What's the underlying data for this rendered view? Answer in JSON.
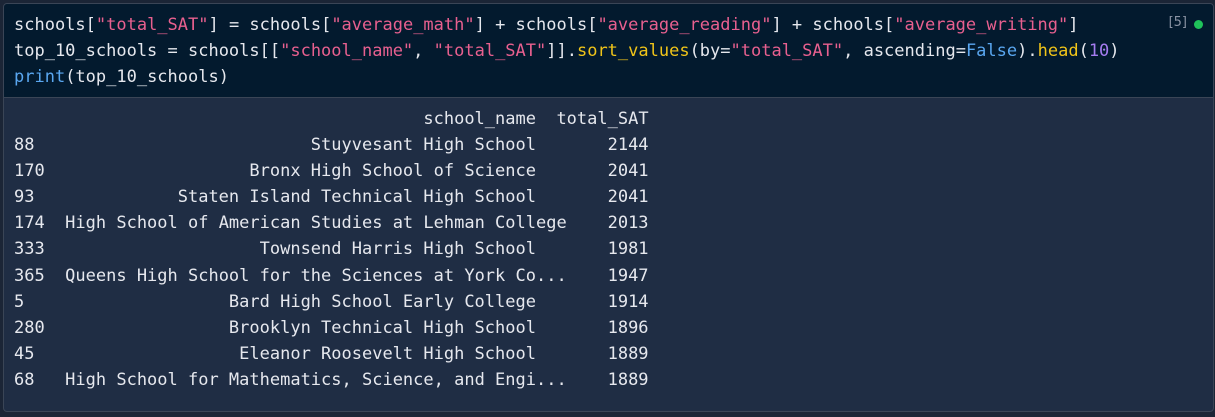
{
  "cell": {
    "execution_count": "[5]",
    "status_color": "#1fc25a",
    "status": "success",
    "code_lines": [
      [
        [
          "t",
          "schools["
        ],
        [
          "s",
          "\"total_SAT\""
        ],
        [
          "t",
          "] = schools["
        ],
        [
          "s",
          "\"average_math\""
        ],
        [
          "t",
          "] + schools["
        ],
        [
          "s",
          "\"average_reading\""
        ],
        [
          "t",
          "] + schools["
        ],
        [
          "s",
          "\"average_writing\""
        ],
        [
          "t",
          "]"
        ]
      ],
      [
        [
          "t",
          "top_10_schools = schools[["
        ],
        [
          "s",
          "\"school_name\""
        ],
        [
          "t",
          ", "
        ],
        [
          "s",
          "\"total_SAT\""
        ],
        [
          "t",
          "]]."
        ],
        [
          "f",
          "sort_values"
        ],
        [
          "t",
          "(by="
        ],
        [
          "s",
          "\"total_SAT\""
        ],
        [
          "t",
          ", ascending="
        ],
        [
          "k",
          "False"
        ],
        [
          "t",
          ")."
        ],
        [
          "f",
          "head"
        ],
        [
          "t",
          "("
        ],
        [
          "n",
          "10"
        ],
        [
          "t",
          ")"
        ]
      ],
      [
        [
          "k",
          "print"
        ],
        [
          "t",
          "(top_10_schools)"
        ]
      ]
    ]
  },
  "output": {
    "columns": [
      "",
      "school_name",
      "total_SAT"
    ],
    "rows": [
      {
        "index": "88",
        "school_name": "Stuyvesant High School",
        "total_SAT": "2144"
      },
      {
        "index": "170",
        "school_name": "Bronx High School of Science",
        "total_SAT": "2041"
      },
      {
        "index": "93",
        "school_name": "Staten Island Technical High School",
        "total_SAT": "2041"
      },
      {
        "index": "174",
        "school_name": "High School of American Studies at Lehman College",
        "total_SAT": "2013"
      },
      {
        "index": "333",
        "school_name": "Townsend Harris High School",
        "total_SAT": "1981"
      },
      {
        "index": "365",
        "school_name": "Queens High School for the Sciences at York Co...",
        "total_SAT": "1947"
      },
      {
        "index": "5",
        "school_name": "Bard High School Early College",
        "total_SAT": "1914"
      },
      {
        "index": "280",
        "school_name": "Brooklyn Technical High School",
        "total_SAT": "1896"
      },
      {
        "index": "45",
        "school_name": "Eleanor Roosevelt High School",
        "total_SAT": "1889"
      },
      {
        "index": "68",
        "school_name": "High School for Mathematics, Science, and Engi...",
        "total_SAT": "1889"
      }
    ]
  }
}
